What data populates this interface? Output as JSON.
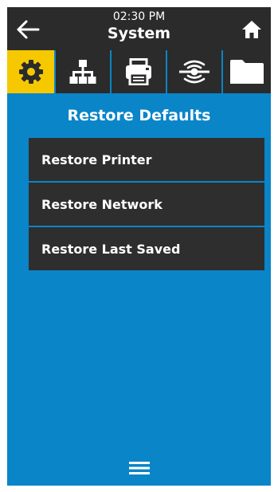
{
  "header": {
    "time": "02:30 PM",
    "title": "System",
    "back_icon": "arrow-left-icon",
    "home_icon": "home-icon"
  },
  "tabs": [
    {
      "name": "settings",
      "icon": "gear-icon",
      "active": true
    },
    {
      "name": "network",
      "icon": "network-icon",
      "active": false
    },
    {
      "name": "print",
      "icon": "printer-icon",
      "active": false
    },
    {
      "name": "rfid",
      "icon": "rfid-icon",
      "active": false
    },
    {
      "name": "storage",
      "icon": "folder-icon",
      "active": false
    }
  ],
  "section": {
    "title": "Restore Defaults"
  },
  "menu": {
    "items": [
      {
        "label": "Restore Printer"
      },
      {
        "label": "Restore Network"
      },
      {
        "label": "Restore Last Saved"
      }
    ]
  },
  "footer": {
    "menu_icon": "hamburger-menu-icon"
  },
  "colors": {
    "background": "#0a85c8",
    "header": "#2b2b2b",
    "active_tab": "#f6c800",
    "menu_item": "#2e2e2e",
    "text": "#ffffff"
  }
}
